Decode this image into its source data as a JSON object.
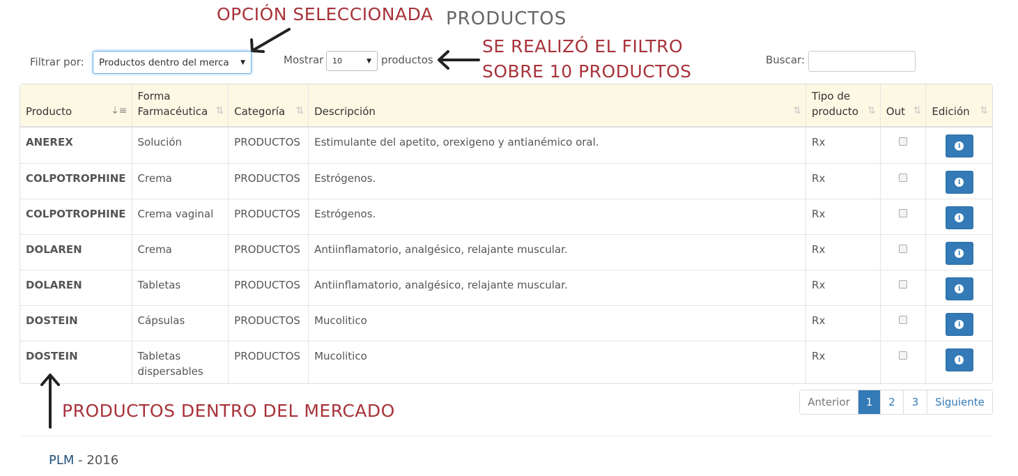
{
  "annotations": {
    "selected_option": "OPCIÓN SELECCIONADA",
    "filter_line1": "SE REALIZÓ EL FILTRO",
    "filter_line2": "SOBRE 10 PRODUCTOS",
    "in_market": "PRODUCTOS DENTRO DEL MERCADO"
  },
  "page_title": "PRODUCTOS",
  "toolbar": {
    "filter_label": "Filtrar por:",
    "filter_value": "Productos dentro del merca",
    "show_label": "Mostrar",
    "show_value": "10",
    "show_suffix": "productos",
    "search_label": "Buscar:",
    "search_value": ""
  },
  "table": {
    "headers": [
      "Producto",
      "Forma Farmacéutica",
      "Categoría",
      "Descripción",
      "Tipo de producto",
      "Out",
      "Edición"
    ],
    "rows": [
      {
        "producto": "ANEREX",
        "forma": "Solución",
        "categoria": "PRODUCTOS",
        "descripcion": "Estimulante del apetito, orexigeno y antianémico oral.",
        "tipo": "Rx",
        "out": false
      },
      {
        "producto": "COLPOTROPHINE",
        "forma": "Crema",
        "categoria": "PRODUCTOS",
        "descripcion": "Estrógenos.",
        "tipo": "Rx",
        "out": false
      },
      {
        "producto": "COLPOTROPHINE",
        "forma": "Crema vaginal",
        "categoria": "PRODUCTOS",
        "descripcion": "Estrógenos.",
        "tipo": "Rx",
        "out": false
      },
      {
        "producto": "DOLAREN",
        "forma": "Crema",
        "categoria": "PRODUCTOS",
        "descripcion": "Antiinflamatorio, analgésico, relajante muscular.",
        "tipo": "Rx",
        "out": false
      },
      {
        "producto": "DOLAREN",
        "forma": "Tabletas",
        "categoria": "PRODUCTOS",
        "descripcion": "Antiinflamatorio, analgésico, relajante muscular.",
        "tipo": "Rx",
        "out": false
      },
      {
        "producto": "DOSTEIN",
        "forma": "Cápsulas",
        "categoria": "PRODUCTOS",
        "descripcion": "Mucolitico",
        "tipo": "Rx",
        "out": false
      },
      {
        "producto": "DOSTEIN",
        "forma": "Tabletas dispersables",
        "categoria": "PRODUCTOS",
        "descripcion": "Mucolitico",
        "tipo": "Rx",
        "out": false
      }
    ]
  },
  "pagination": {
    "prev": "Anterior",
    "pages": [
      "1",
      "2",
      "3"
    ],
    "next": "Siguiente",
    "current": "1"
  },
  "footer": {
    "brand": "PLM",
    "separator": " - ",
    "year": "2016"
  },
  "colors": {
    "annotation": "#a8323a",
    "header_bg": "#fcf8e3",
    "primary": "#337ab7"
  },
  "icons": {
    "info": "info-circle-icon",
    "sort": "sort-icon",
    "arrow": "arrow-icon"
  }
}
